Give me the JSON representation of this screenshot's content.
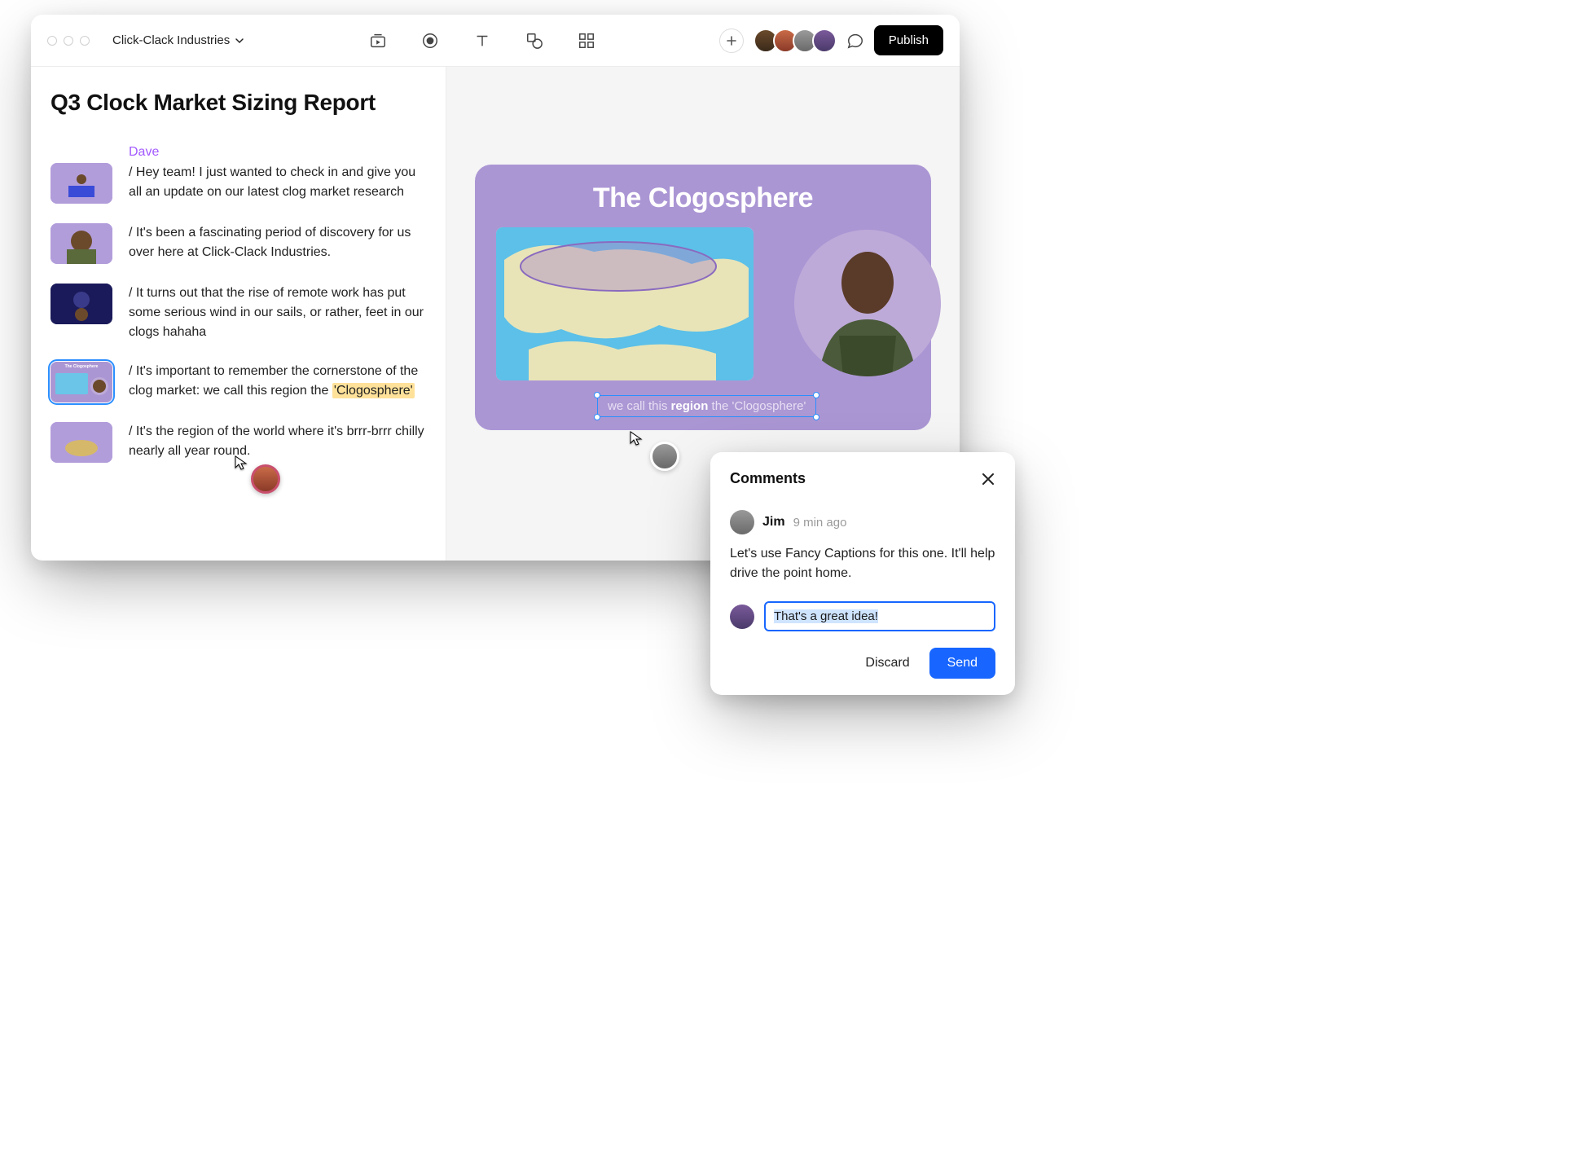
{
  "titlebar": {
    "project_name": "Click-Clack Industries",
    "publish_label": "Publish"
  },
  "doc": {
    "title": "Q3 Clock Market Sizing Report",
    "author": "Dave"
  },
  "script": [
    {
      "text": "/ Hey team! I just wanted to check in and give you all an update on our latest clog market research"
    },
    {
      "text": "/ It's been a fascinating period of discovery for us over here at Click-Clack Industries."
    },
    {
      "text": "/ It turns out that the rise of remote work has put some serious wind in our sails, or rather, feet in our clogs hahaha"
    },
    {
      "prefix": "/ It's important to remember the cornerstone of the clog market: we call this region the ",
      "highlighted": "'Clogosphere'"
    },
    {
      "text": "/ It's the region of the world where it's brrr-brrr chilly nearly all year round."
    }
  ],
  "slide": {
    "title": "The Clogosphere",
    "caption_pre": "we call this ",
    "caption_bold": "region",
    "caption_post": " the 'Clogosphere'"
  },
  "comments": {
    "title": "Comments",
    "author": "Jim",
    "time": "9 min ago",
    "body": "Let's use Fancy Captions for this one. It'll help drive the point home.",
    "reply_value": "That's a great idea!",
    "discard_label": "Discard",
    "send_label": "Send"
  }
}
